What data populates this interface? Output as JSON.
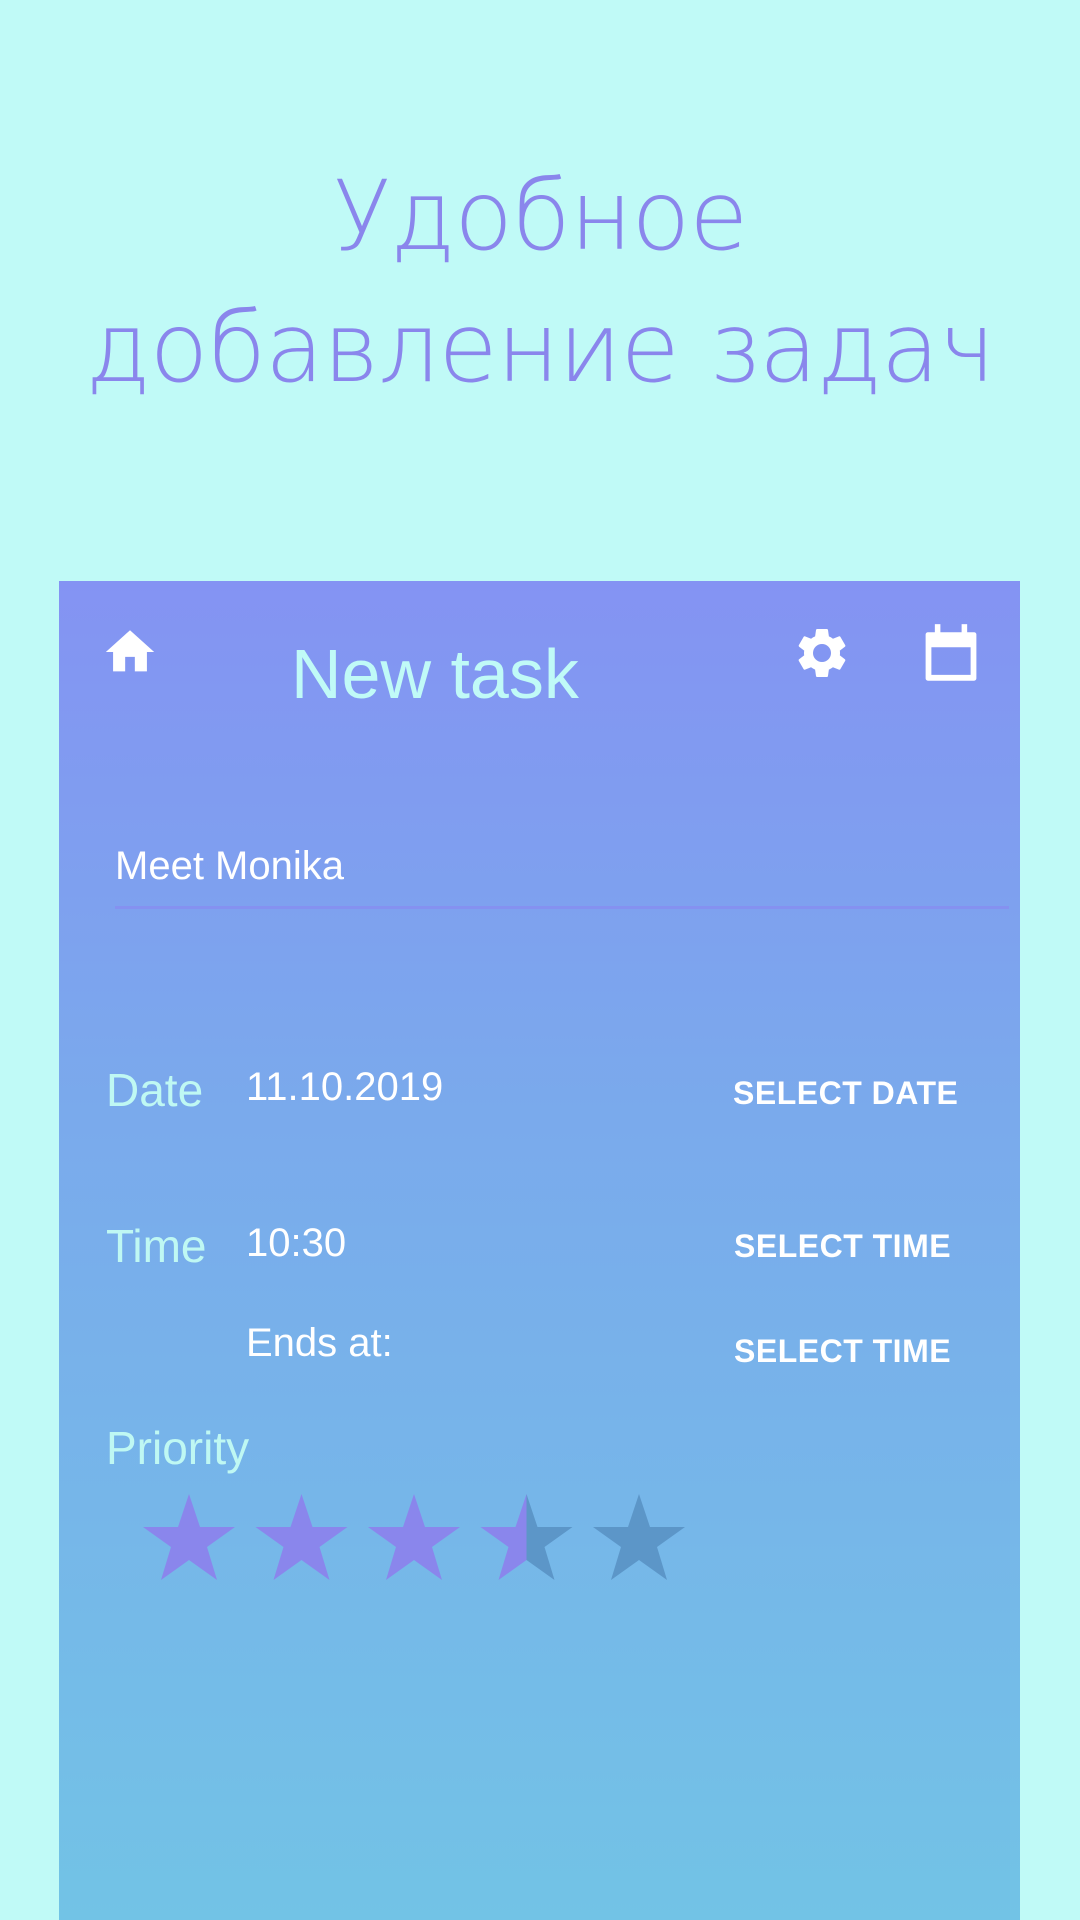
{
  "promo": {
    "headline": "Удобное добавление задач"
  },
  "toolbar": {
    "title": "New task",
    "icons": [
      "home-icon",
      "gear-icon",
      "calendar-icon"
    ]
  },
  "task": {
    "name": "Meet Monika"
  },
  "date": {
    "label": "Date",
    "value": "11.10.2019",
    "button": "SELECT DATE"
  },
  "time": {
    "label": "Time",
    "value": "10:30",
    "button": "SELECT TIME",
    "ends_label": "Ends at:",
    "ends_button": "SELECT TIME"
  },
  "priority": {
    "label": "Priority",
    "rating": 3.5,
    "max": 5
  },
  "colors": {
    "background": "#c0faf7",
    "headline": "#8a86ec",
    "accent_light": "#bff8f3",
    "star_filled": "#8a86ec",
    "star_empty": "#5c96c8",
    "gradient_top": "#8493f3",
    "gradient_bottom": "#72c3e6"
  }
}
